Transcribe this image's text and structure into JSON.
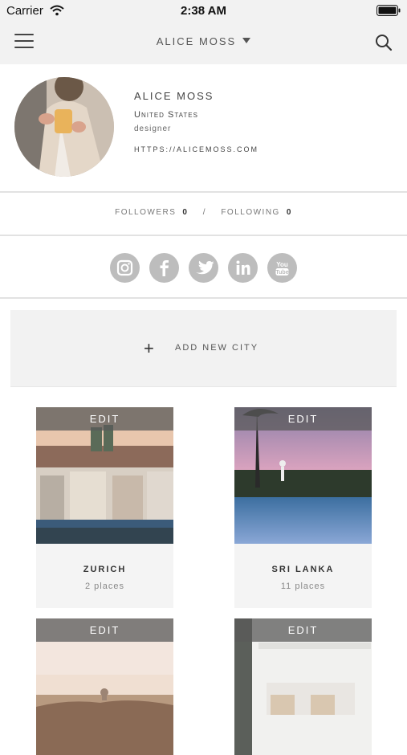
{
  "status_bar": {
    "carrier": "Carrier",
    "time": "2:38 AM"
  },
  "nav": {
    "title": "ALICE MOSS"
  },
  "profile": {
    "name": "ALICE MOSS",
    "country": "United States",
    "occupation": "designer",
    "website": "HTTPS://ALICEMOSS.COM"
  },
  "stats": {
    "followers_label": "FOLLOWERS",
    "followers_count": "0",
    "separator": "/",
    "following_label": "FOLLOWING",
    "following_count": "0"
  },
  "social": [
    "instagram-icon",
    "facebook-icon",
    "twitter-icon",
    "linkedin-icon",
    "youtube-icon"
  ],
  "add_city": {
    "label": "ADD NEW CITY",
    "plus": "+"
  },
  "cities": [
    {
      "edit_label": "EDIT",
      "name": "ZURICH",
      "places": "2 places"
    },
    {
      "edit_label": "EDIT",
      "name": "SRI LANKA",
      "places": "11 places"
    },
    {
      "edit_label": "EDIT"
    },
    {
      "edit_label": "EDIT"
    }
  ],
  "colors": {
    "nav_bg": "#f2f2f2",
    "icon_grey": "#bdbdbd",
    "edit_overlay": "#5a5a5a"
  }
}
